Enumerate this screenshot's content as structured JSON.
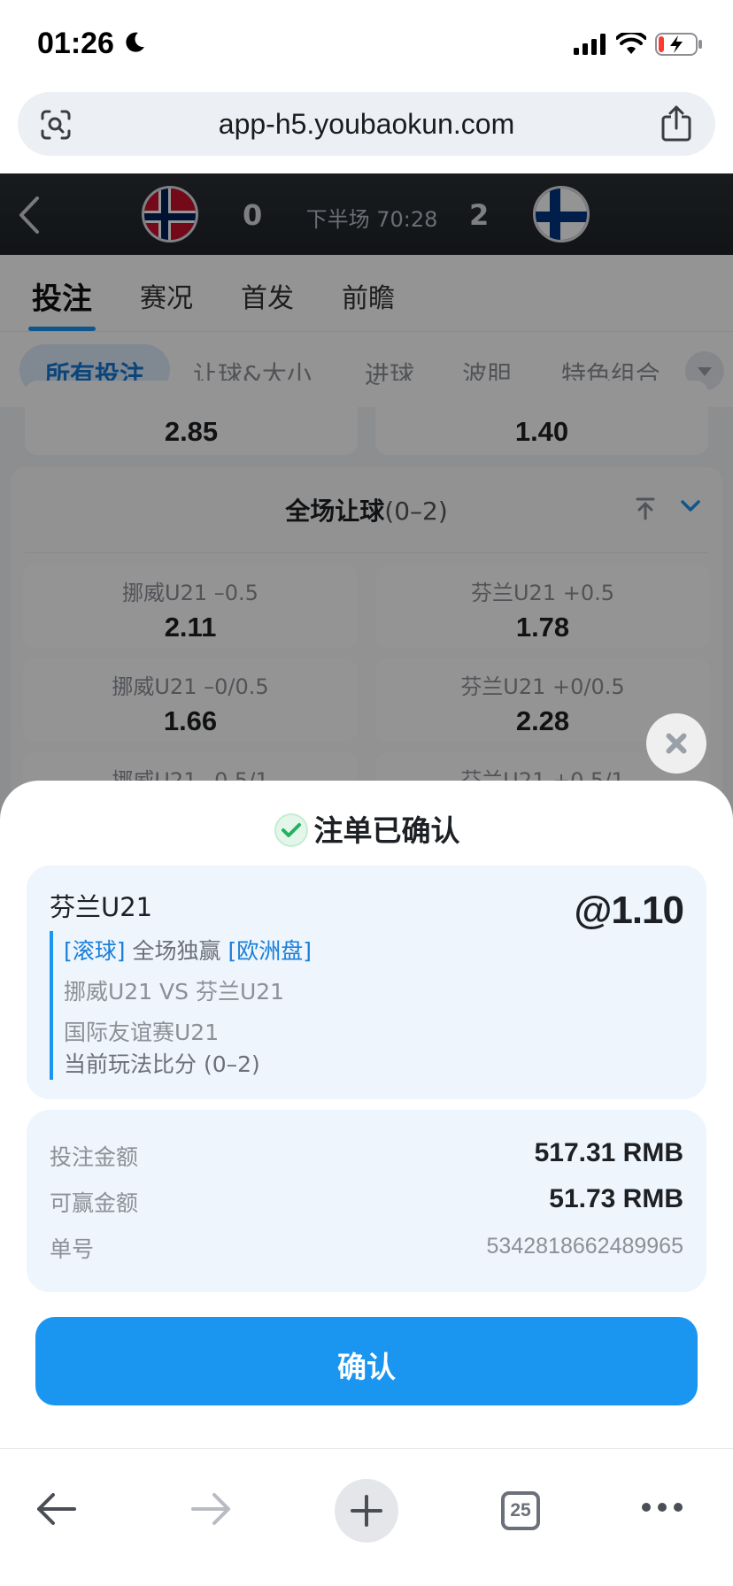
{
  "status_bar": {
    "time": "01:26"
  },
  "browser": {
    "url": "app-h5.youbaokun.com",
    "tab_count": "25"
  },
  "match": {
    "home_score": "0",
    "away_score": "2",
    "time": "下半场 70:28"
  },
  "main_tabs": [
    "投注",
    "赛况",
    "首发",
    "前瞻"
  ],
  "sub_tabs": [
    "所有投注",
    "让球&大小",
    "进球",
    "波胆",
    "特色组合"
  ],
  "odds_top_row": [
    "2.85",
    "1.40"
  ],
  "section": {
    "title": "全场让球",
    "score": "(0–2)",
    "rows": [
      {
        "left_label": "挪威U21 –0.5",
        "left_odds": "2.11",
        "right_label": "芬兰U21 +0.5",
        "right_odds": "1.78"
      },
      {
        "left_label": "挪威U21 –0/0.5",
        "left_odds": "1.66",
        "right_label": "芬兰U21 +0/0.5",
        "right_odds": "2.28"
      },
      {
        "left_label": "挪威U21 –0.5/1",
        "left_odds": "",
        "right_label": "芬兰U21 +0.5/1",
        "right_odds": ""
      }
    ]
  },
  "sheet": {
    "title": "注单已确认",
    "bet": {
      "selection": "芬兰U21",
      "odds": "@1.10",
      "tag_live": "[滚球]",
      "market": "全场独赢",
      "tag_odds_type": "[欧洲盘]",
      "matchup": "挪威U21 VS 芬兰U21",
      "league": "国际友谊赛U21",
      "current_score": "当前玩法比分 (0–2)"
    },
    "summary": {
      "stake_label": "投注金额",
      "stake_value": "517.31 RMB",
      "win_label": "可赢金额",
      "win_value": "51.73 RMB",
      "order_label": "单号",
      "order_value": "5342818662489965"
    },
    "confirm_label": "确认"
  },
  "colors": {
    "accent": "#1a96f0",
    "card_bg": "#eef5fc",
    "success": "#22b35e"
  }
}
